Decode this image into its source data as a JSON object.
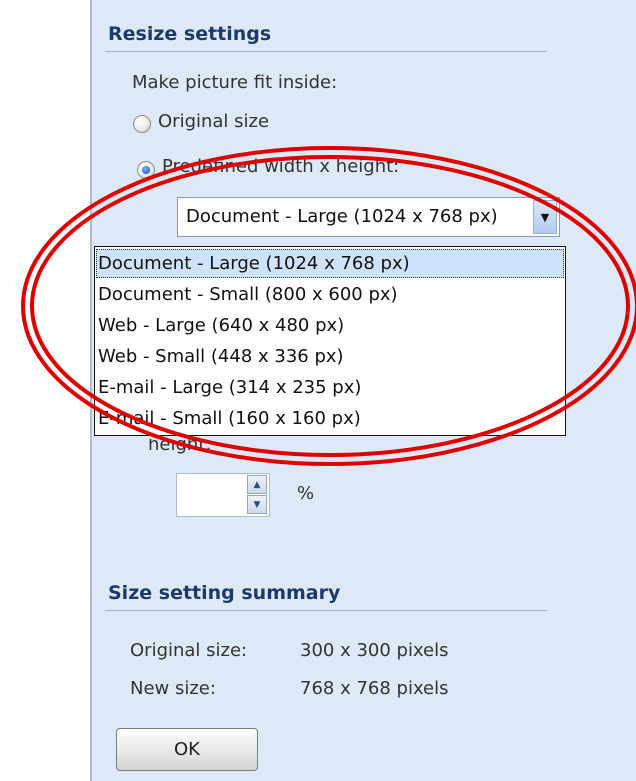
{
  "resize": {
    "title": "Resize settings",
    "fit_label": "Make picture fit inside:",
    "radio_original": "Original size",
    "radio_predefined": "Predefined width x height:",
    "selected_value": "Document - Large (1024 x 768 px)",
    "options": [
      "Document - Large (1024 x 768 px)",
      "Document - Small (800 x 600 px)",
      "Web - Large (640 x 480 px)",
      "Web - Small (448 x 336 px)",
      "E-mail - Large (314 x 235 px)",
      "E-mail - Small (160 x 160 px)"
    ],
    "height_label": "height:",
    "percent_sign": "%"
  },
  "summary": {
    "title": "Size setting summary",
    "original_label": "Original size:",
    "original_value": "300 x 300 pixels",
    "new_label": "New size:",
    "new_value": "768 x 768 pixels"
  },
  "ok_label": "OK",
  "colors": {
    "highlight": "#e00000",
    "panel_bg": "#dde9f7",
    "section_title": "#1b3a6b"
  }
}
